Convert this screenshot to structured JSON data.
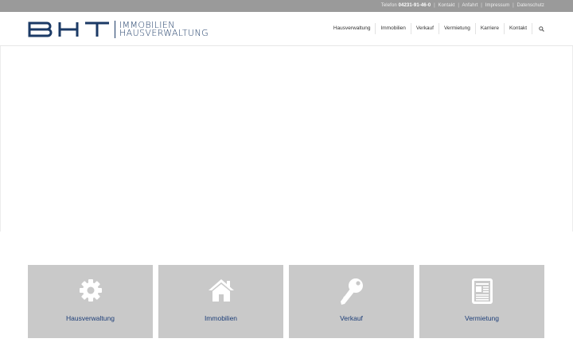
{
  "topbar": {
    "phone_label": "Telefon",
    "phone_number": "04231-91-46-0",
    "links": [
      "Kontakt",
      "Anfahrt",
      "Impressum",
      "Datenschutz"
    ]
  },
  "logo": {
    "mark": "BHT",
    "line1": "IMMOBILIEN",
    "line2": "HAUSVERWALTUNG"
  },
  "nav": {
    "items": [
      "Hausverwaltung",
      "Immobilien",
      "Verkauf",
      "Vermietung",
      "Karriere",
      "Kontakt"
    ],
    "search_icon": "search-icon"
  },
  "tiles": [
    {
      "label": "Hausverwaltung",
      "icon": "gear-icon"
    },
    {
      "label": "Immobilien",
      "icon": "house-icon"
    },
    {
      "label": "Verkauf",
      "icon": "key-icon"
    },
    {
      "label": "Vermietung",
      "icon": "newspaper-icon"
    }
  ],
  "colors": {
    "brand": "#1b3a66",
    "topbar": "#9a9a9a",
    "tile": "#c9c9c9",
    "tile_label": "#1d3e78"
  }
}
